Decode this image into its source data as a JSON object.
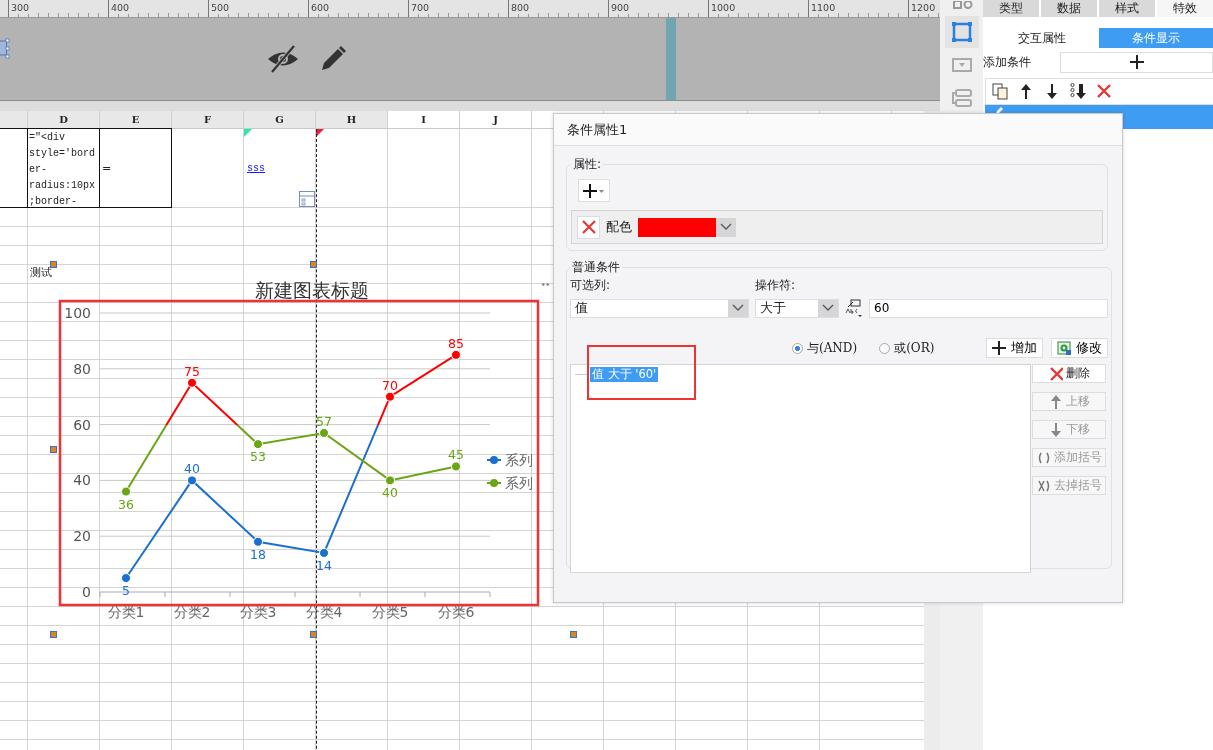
{
  "ruler": {
    "labels": [
      "300",
      "400",
      "500",
      "600",
      "700",
      "800",
      "900",
      "1000",
      "1100",
      "1200"
    ]
  },
  "sheet": {
    "columns": [
      {
        "label": "D",
        "shaded": true
      },
      {
        "label": "E",
        "shaded": true
      },
      {
        "label": "F",
        "shaded": true
      },
      {
        "label": "G",
        "shaded": true
      },
      {
        "label": "H",
        "shaded": true
      },
      {
        "label": "I",
        "shaded": false
      },
      {
        "label": "J",
        "shaded": false
      }
    ],
    "rows": [
      {
        "kind": "tall",
        "cells": [
          {
            "kind": "empty",
            "bordered": true
          },
          {
            "kind": "code",
            "text": "=\"<div style='border-radius:10px;border-",
            "bordered": true
          },
          {
            "kind": "plain",
            "text": "=",
            "bordered": true
          },
          null,
          {
            "kind": "link",
            "text": "sss",
            "color": "#2ee6b0",
            "bordered": false
          },
          {
            "kind": "empty",
            "color": "#e8213a",
            "bordered": false
          }
        ]
      },
      {
        "kind": "normal"
      },
      {
        "kind": "normal"
      },
      {
        "kind": "normal"
      },
      {
        "kind": "normal",
        "cells": [
          null,
          {
            "kind": "plain",
            "text": "测试"
          }
        ]
      }
    ]
  },
  "chart": {
    "chart_data": {
      "type": "line",
      "title": "新建图表标题",
      "categories": [
        "分类1",
        "分类2",
        "分类3",
        "分类4",
        "分类5",
        "分类6"
      ],
      "series": [
        {
          "name": "系列",
          "color": "#1a6fd0",
          "marker": "circle",
          "values": [
            5,
            40,
            18,
            14,
            70,
            85
          ]
        },
        {
          "name": "系列",
          "color": "#6aa513",
          "marker": "circle",
          "values": [
            36,
            75,
            53,
            57,
            40,
            45
          ]
        }
      ],
      "ylim": [
        0,
        100
      ],
      "yticks": [
        0,
        20,
        40,
        60,
        80,
        100
      ],
      "grid": true,
      "data_labels": true
    }
  },
  "side_tools": [
    {
      "kind": "eo",
      "selected": false
    },
    {
      "kind": "frame",
      "selected": true
    },
    {
      "kind": "dropdown",
      "selected": false
    },
    {
      "kind": "widget",
      "selected": false
    }
  ],
  "panel": {
    "tabs": [
      {
        "label": "类型",
        "selected": false
      },
      {
        "label": "数据",
        "selected": false
      },
      {
        "label": "样式",
        "selected": false
      },
      {
        "label": "特效",
        "selected": true
      }
    ],
    "subtabs": [
      {
        "label": "交互属性",
        "selected": false
      },
      {
        "label": "条件显示",
        "selected": true
      }
    ],
    "add_label": "添加条件",
    "toolbar": [
      {
        "kind": "copy"
      },
      {
        "kind": "up"
      },
      {
        "kind": "down"
      },
      {
        "kind": "bottom"
      },
      {
        "kind": "delete"
      }
    ],
    "conditions": [
      {
        "selected": true
      }
    ]
  },
  "dialog": {
    "title": "条件属性1",
    "properties": {
      "legend": "属性:",
      "items": [
        {
          "label": "配色",
          "color": "#ff0000"
        }
      ]
    },
    "condition": {
      "legend": "普通条件",
      "column_label": "可选列:",
      "column_value": "值",
      "operator_label": "操作符:",
      "operator_value": "大于",
      "value": "60",
      "logic": [
        {
          "label": "与(AND)",
          "selected": true
        },
        {
          "label": "或(OR)",
          "selected": false
        }
      ],
      "actions": [
        {
          "kind": "add",
          "label": "增加"
        },
        {
          "kind": "edit",
          "label": "修改"
        }
      ],
      "items": [
        {
          "text": "值 大于 '60'",
          "selected": true
        }
      ],
      "side_buttons": [
        {
          "kind": "delete",
          "label": "删除",
          "disabled": false
        },
        {
          "kind": "up",
          "label": "上移",
          "disabled": true
        },
        {
          "kind": "down",
          "label": "下移",
          "disabled": true
        },
        {
          "kind": "paren",
          "label": "添加括号",
          "disabled": true
        },
        {
          "kind": "unparen",
          "label": "去掉括号",
          "disabled": true
        }
      ]
    }
  }
}
